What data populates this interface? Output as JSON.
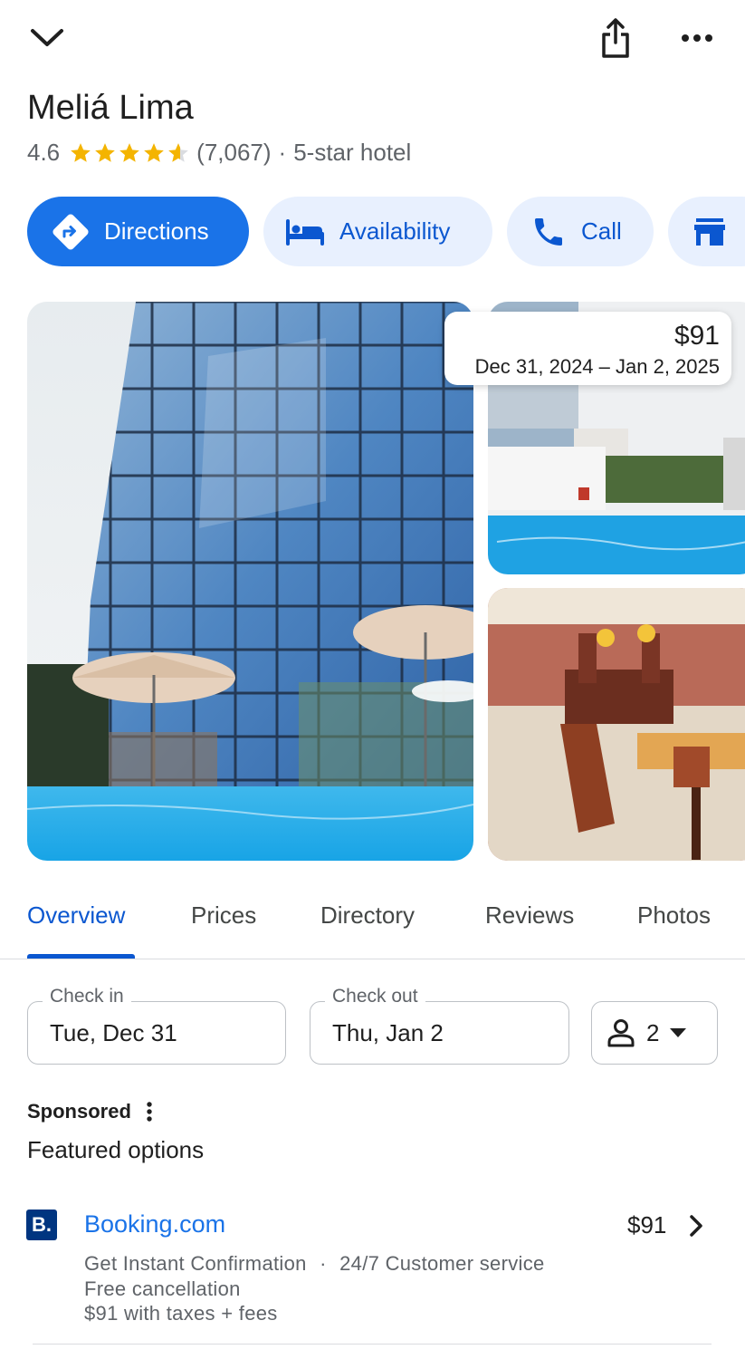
{
  "header": {
    "collapse_icon": "chevron-down-icon",
    "share_icon": "share-icon",
    "more_icon": "more-horizontal-icon"
  },
  "place": {
    "name": "Meliá Lima",
    "rating": "4.6",
    "rating_value": 4.6,
    "rating_max": 5,
    "reviews_count": "(7,067)",
    "separator": "·",
    "category": "5-star hotel"
  },
  "actions": [
    {
      "label": "Directions",
      "icon": "directions-icon"
    },
    {
      "label": "Availability",
      "icon": "bed-icon"
    },
    {
      "label": "Call",
      "icon": "phone-icon"
    },
    {
      "label": "",
      "icon": "store-icon"
    }
  ],
  "photos": {
    "price": "$91",
    "dates": "Dec 31, 2024 – Jan 2, 2025"
  },
  "tabs": [
    {
      "label": "Overview",
      "active": true
    },
    {
      "label": "Prices",
      "active": false
    },
    {
      "label": "Directory",
      "active": false
    },
    {
      "label": "Reviews",
      "active": false
    },
    {
      "label": "Photos",
      "active": false
    }
  ],
  "booking_form": {
    "check_in_label": "Check in",
    "check_in_value": "Tue, Dec 31",
    "check_out_label": "Check out",
    "check_out_value": "Thu, Jan 2",
    "guests": "2"
  },
  "sponsored": {
    "label": "Sponsored",
    "heading": "Featured options"
  },
  "offers": [
    {
      "logo_text": "B.",
      "name": "Booking.com",
      "price": "$91",
      "feature_1": "Get Instant Confirmation",
      "separator": "·",
      "feature_2": "24/7 Customer service",
      "feature_3": "Free cancellation",
      "price_note": "$91 with taxes + fees"
    }
  ],
  "colors": {
    "primary": "#1a73e8",
    "chip_bg": "#e8f0fe",
    "active_tab": "#0b57d0",
    "star": "#f4b400"
  }
}
